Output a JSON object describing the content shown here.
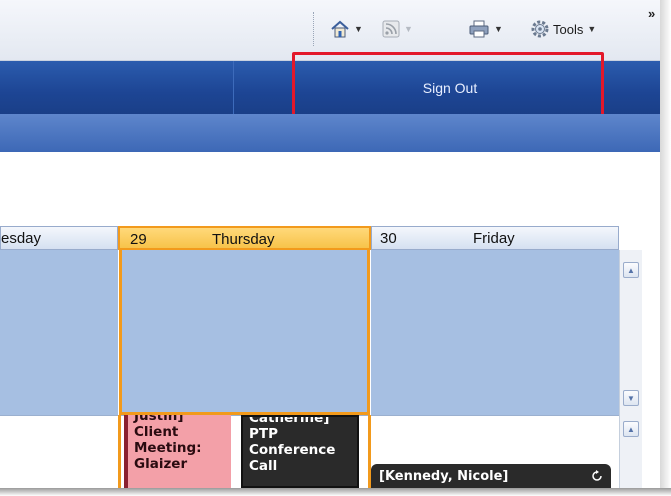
{
  "toolbar": {
    "home_icon": "home-icon",
    "feeds_icon": "feeds-icon",
    "print_icon": "print-icon",
    "tools_icon": "gear-icon",
    "tools_label": "Tools",
    "overflow": "»"
  },
  "header": {
    "sign_out_label": "Sign Out",
    "highlight_color": "#e3182a",
    "accent": "#1d4594"
  },
  "calendar": {
    "days": [
      {
        "number": "",
        "name": "esday"
      },
      {
        "number": "29",
        "name": "Thursday"
      },
      {
        "number": "30",
        "name": "Friday"
      }
    ],
    "today_color": "#f29a1c",
    "appointments": [
      {
        "lines": [
          "Justin]",
          "Client",
          "Meeting:",
          "Glaizer"
        ],
        "color": "#f3a0a8"
      },
      {
        "lines": [
          "Catherine]",
          "PTP",
          "Conference",
          "Call"
        ],
        "color": "#2a2a2a"
      },
      {
        "lines": [
          "[Kennedy, Nicole]"
        ],
        "color": "#2a2a2a"
      }
    ]
  }
}
